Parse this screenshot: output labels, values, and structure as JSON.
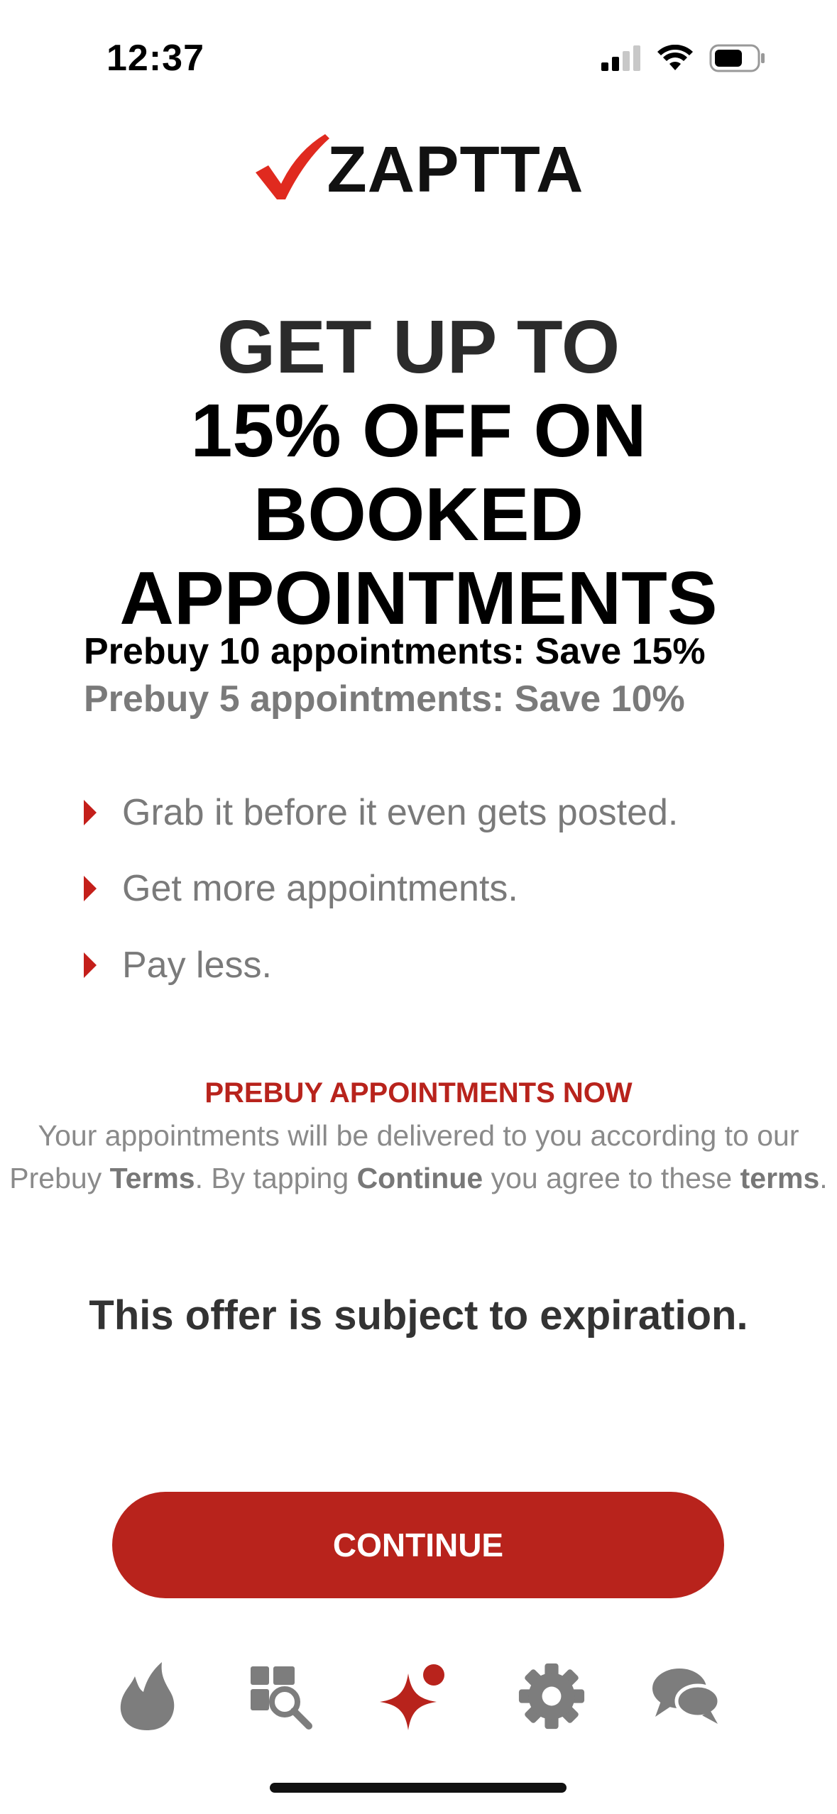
{
  "status": {
    "time": "12:37"
  },
  "brand": {
    "name": "ZAPTTA",
    "check_color": "#e02a1f"
  },
  "headline": {
    "line1": "GET UP TO",
    "line2": "15% OFF ON BOOKED",
    "line3": "APPOINTMENTS"
  },
  "tiers": [
    "Prebuy 10 appointments: Save 15%",
    "Prebuy 5 appointments: Save 10%"
  ],
  "bullets": [
    "Grab it before it even gets posted.",
    "Get more appointments.",
    "Pay less."
  ],
  "prebuy": {
    "title": "PREBUY APPOINTMENTS NOW",
    "text_1": "Your appointments will be delivered to you according to our Prebuy ",
    "terms_link": "Terms",
    "text_2": ". By tapping ",
    "continue_word": "Continue",
    "text_3": " you agree to these ",
    "terms_word": "terms",
    "text_4": "."
  },
  "expiration_note": "This offer is subject to expiration.",
  "continue_button": "CONTINUE",
  "colors": {
    "accent": "#b8231c",
    "icon_gray": "#7d7d7d"
  },
  "tabs": [
    {
      "icon": "flame-icon"
    },
    {
      "icon": "search-grid-icon"
    },
    {
      "icon": "sparkle-icon",
      "active": true
    },
    {
      "icon": "gear-icon"
    },
    {
      "icon": "chat-bubbles-icon"
    }
  ]
}
